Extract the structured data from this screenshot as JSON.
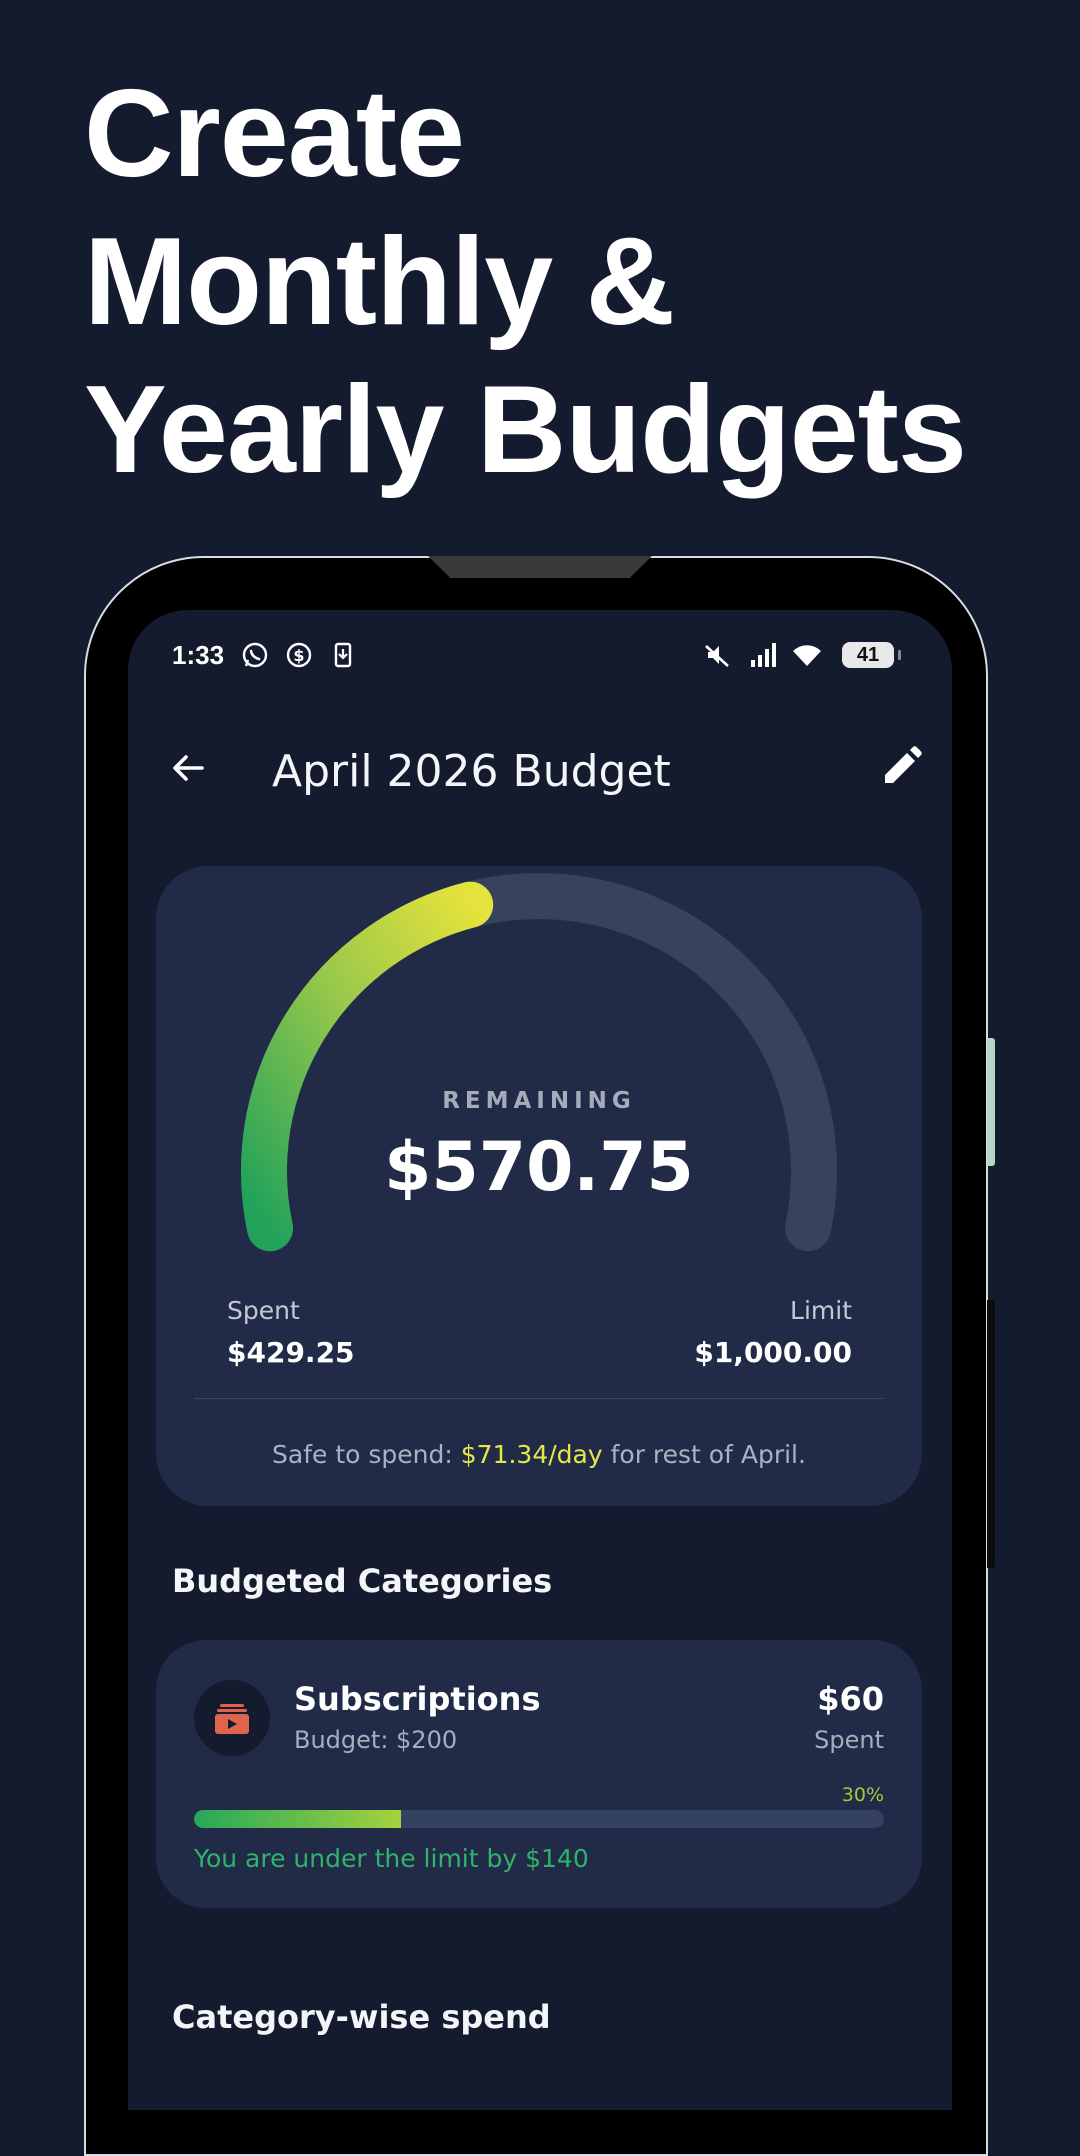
{
  "headline": {
    "line1": "Create",
    "line2": "Monthly &",
    "line3": "Yearly Budgets"
  },
  "status_bar": {
    "time": "1:33",
    "icons": [
      "whatsapp-icon",
      "dollar-circle-icon",
      "download-icon",
      "mute-icon",
      "signal-icon",
      "wifi-icon"
    ],
    "battery": "41"
  },
  "app_bar": {
    "title": "April 2026 Budget",
    "back_icon": "arrow-left-icon",
    "edit_icon": "pencil-icon"
  },
  "summary": {
    "remaining_label": "REMAINING",
    "remaining_value": "$570.75",
    "spent_label": "Spent",
    "spent_value": "$429.25",
    "limit_label": "Limit",
    "limit_value": "$1,000.00",
    "spent_fraction": 0.429,
    "safe_prefix": "Safe to spend: ",
    "safe_amount": "$71.34/day",
    "safe_suffix": " for rest of April."
  },
  "sections": {
    "budgeted_categories": "Budgeted Categories",
    "category_wise": "Category-wise spend"
  },
  "categories": [
    {
      "name": "Subscriptions",
      "budget": "Budget: $200",
      "amount": "$60",
      "amount_label": "Spent",
      "percent": "30%",
      "fraction": 0.3,
      "message": "You are under the limit by $140",
      "icon": "subscription-play-icon"
    }
  ],
  "colors": {
    "background": "#141b2f",
    "card": "#212b48",
    "accent_yellow": "#e5e84a",
    "accent_green": "#2fb36a",
    "subscription_red": "#e0634e"
  }
}
